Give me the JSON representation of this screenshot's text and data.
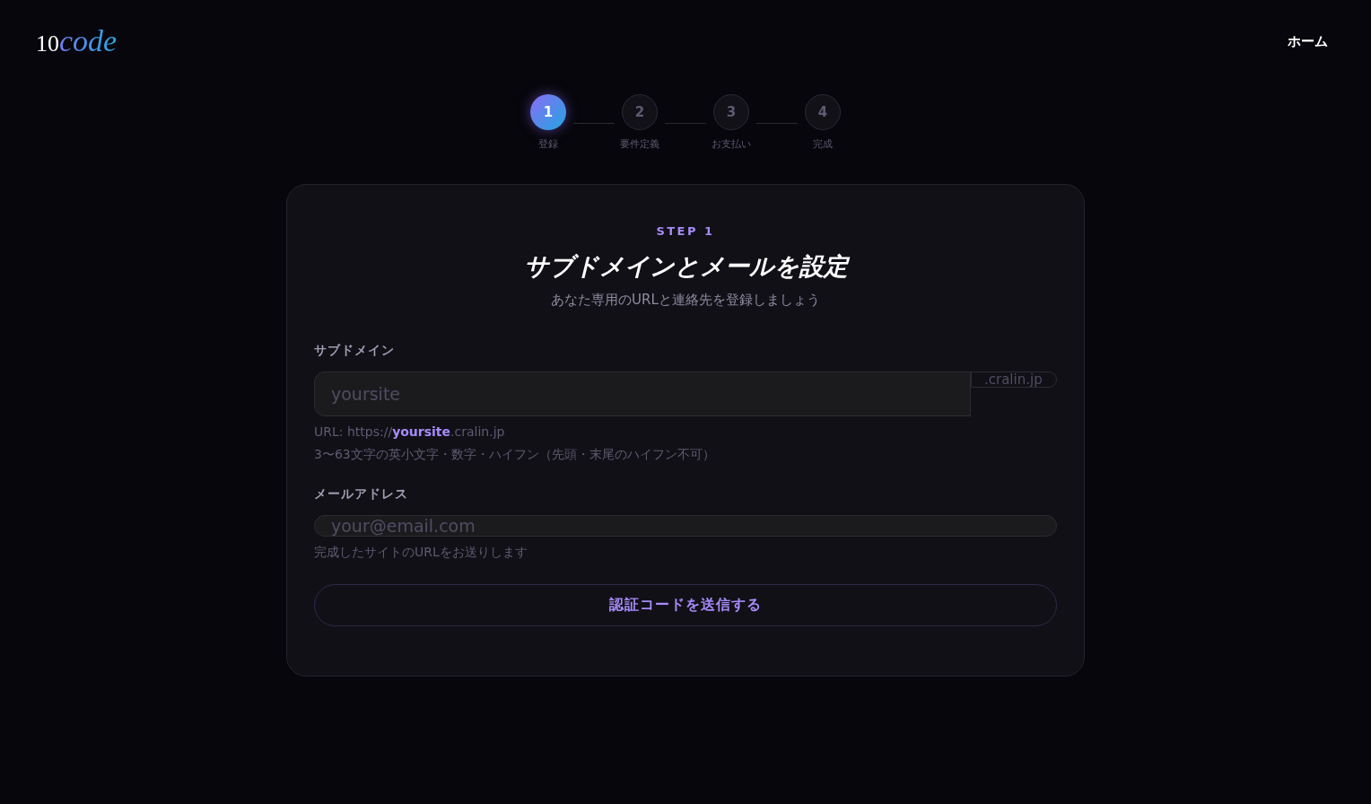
{
  "header": {
    "logo": {
      "prefix": "10",
      "suffix": "code"
    },
    "nav": [
      {
        "label": "ホーム"
      }
    ]
  },
  "steps": [
    {
      "number": "1",
      "label": "登録",
      "selected": true
    },
    {
      "number": "2",
      "label": "要件定義",
      "selected": false
    },
    {
      "number": "3",
      "label": "お支払い",
      "selected": false
    },
    {
      "number": "4",
      "label": "完成",
      "selected": false
    }
  ],
  "card": {
    "eyebrow": "STEP 1",
    "title": "サブドメインとメールを設定",
    "subtitle": "あなた専用のURLと連絡先を登録しましょう",
    "fields": [
      {
        "kind": "subdomain",
        "label": "サブドメイン",
        "placeholder": "yoursite",
        "suffix": ".cralin.jp",
        "hints": [
          "URL: https://**yoursite**.cralin.jp",
          "3〜63文字の英小文字・数字・ハイフン（先頭・末尾のハイフン不可）"
        ]
      },
      {
        "kind": "email",
        "label": "メールアドレス",
        "placeholder": "your@email.com",
        "hints": [
          "完成したサイトのURLをお送りします"
        ]
      }
    ],
    "button": "認証コードを送信する"
  }
}
